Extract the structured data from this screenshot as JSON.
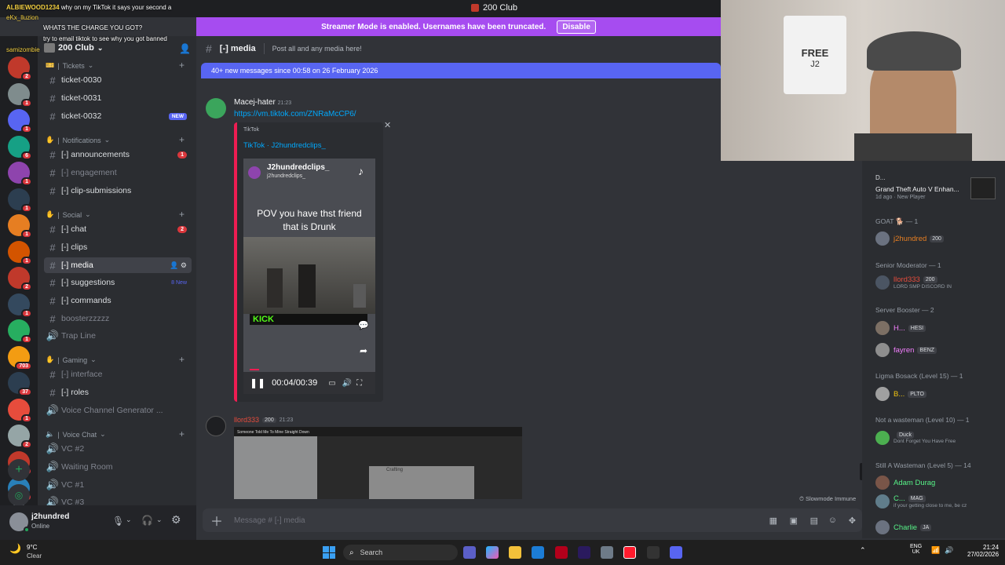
{
  "window": {
    "title": "200 Club"
  },
  "streamer_mode": {
    "text": "Streamer Mode is enabled. Usernames have been truncated.",
    "button": "Disable"
  },
  "chat_overlay": [
    {
      "user": "ALBIEWOOD1234",
      "text": "why on my TikTok it says your second a"
    },
    {
      "user": "eKx_lluzion",
      "text": ""
    },
    {
      "user": "",
      "text": "WHATS THE CHARGE YOU GOT?"
    },
    {
      "user": "",
      "text": "try to email tiktok to see why you got banned"
    },
    {
      "user": "samizombie",
      "text": ""
    }
  ],
  "server": {
    "name": "200 Club"
  },
  "rail_badges": [
    "2",
    "1",
    "1",
    "6",
    "1",
    "1",
    "1",
    "1",
    "2",
    "1",
    "1",
    "703",
    "37",
    "1",
    "2",
    "6",
    "4",
    "35"
  ],
  "categories": {
    "tickets": "Tickets",
    "notifications": "Notifications",
    "social": "Social",
    "gaming": "Gaming",
    "voice": "Voice Chat"
  },
  "channels": [
    {
      "id": "ticket-0030",
      "name": "ticket-0030",
      "icon": "#"
    },
    {
      "id": "ticket-0031",
      "name": "ticket-0031",
      "icon": "#"
    },
    {
      "id": "ticket-0032",
      "name": "ticket-0032",
      "icon": "#",
      "new": "NEW"
    },
    {
      "id": "announcements",
      "name": "[-] announcements",
      "icon": "#",
      "count": "1"
    },
    {
      "id": "engagement",
      "name": "[-] engagement",
      "icon": "#",
      "dim": true
    },
    {
      "id": "clip-submissions",
      "name": "[-] clip-submissions",
      "icon": "#"
    },
    {
      "id": "chat",
      "name": "[-] chat",
      "icon": "#",
      "count": "2"
    },
    {
      "id": "clips",
      "name": "[-] clips",
      "icon": "#"
    },
    {
      "id": "media",
      "name": "[-] media",
      "icon": "#",
      "active": true
    },
    {
      "id": "suggestions",
      "name": "[-] suggestions",
      "icon": "#",
      "newtext": "8 New"
    },
    {
      "id": "commands",
      "name": "[-] commands",
      "icon": "#"
    },
    {
      "id": "boosterzzzzz",
      "name": "boosterzzzzz",
      "icon": "#",
      "dim": true
    },
    {
      "id": "trap-line",
      "name": "Trap Line",
      "icon": "🔊",
      "dim": true
    },
    {
      "id": "interface",
      "name": "[-] interface",
      "icon": "#",
      "dim": true
    },
    {
      "id": "roles",
      "name": "[-] roles",
      "icon": "#"
    },
    {
      "id": "voice-gen",
      "name": "Voice Channel Generator ...",
      "icon": "🔊",
      "dim": true
    },
    {
      "id": "vc2",
      "name": "VC #2",
      "icon": "🔊",
      "dim": true
    },
    {
      "id": "waiting-room",
      "name": "Waiting Room",
      "icon": "🔊",
      "dim": true
    },
    {
      "id": "vc1",
      "name": "VC #1",
      "icon": "🔊",
      "dim": true
    },
    {
      "id": "vc3",
      "name": "VC #3",
      "icon": "🔊",
      "dim": true
    }
  ],
  "user": {
    "name": "j2hundred",
    "status": "Online"
  },
  "channel_header": {
    "name": "[-] media",
    "topic": "Post all and any media here!"
  },
  "new_messages_bar": "40+ new messages since 00:58 on 26 February 2026",
  "messages": [
    {
      "author": "Macej-hater",
      "time": "21:23",
      "link": "https://vm.tiktok.com/ZNRaMcCP6/",
      "embed": {
        "provider": "TikTok",
        "title": "TikTok · J2hundredclips_",
        "account": "J2hundredclips_",
        "handle": "j2hundredclips_",
        "caption": "POV  you have thst friend that is Drunk",
        "brand": "KICK",
        "time": "00:04/00:39"
      }
    },
    {
      "author": "llord333",
      "tag": "200",
      "time": "21:23",
      "image_caption": "Someone Told Me To Mine Straight Down",
      "crafting": "Crafting"
    }
  ],
  "slowmode": "Slowmode Immune",
  "message_placeholder": "Message # [-] media",
  "activity": {
    "user": "D...",
    "game": "Grand Theft Auto V Enhan...",
    "meta": "1d ago",
    "badge": "New Player"
  },
  "member_groups": [
    {
      "header": "GOAT 🐕 — 1",
      "members": [
        {
          "name": "j2hundred",
          "tag": "200",
          "color": "#e67e22"
        }
      ]
    },
    {
      "header": "Senior Moderator — 1",
      "members": [
        {
          "name": "llord333",
          "tag": "200",
          "color": "#e74c3c",
          "sub": "LORD SMP DISCORD IN"
        }
      ]
    },
    {
      "header": "Server Booster — 2",
      "members": [
        {
          "name": "H...",
          "tag": "HESI",
          "color": "#f47fff"
        },
        {
          "name": "fayren",
          "tag": "BENZ",
          "color": "#f47fff"
        }
      ]
    },
    {
      "header": "Ligma Bosack (Level 15) — 1",
      "members": [
        {
          "name": "B...",
          "tag": "PLTO",
          "color": "#f1c40f"
        }
      ]
    },
    {
      "header": "Not a wasteman (Level 10) — 1",
      "members": [
        {
          "name": "",
          "tag": "Duck",
          "color": "#3498db",
          "sub": "Dont Forget You Have Free"
        }
      ]
    },
    {
      "header": "Still A Wasteman (Level 5) — 14",
      "members": [
        {
          "name": "Adam Durag",
          "color": "#57f287"
        },
        {
          "name": "C...",
          "tag": "MAG",
          "color": "#57f287",
          "sub": "if your getting close to me, be cz"
        },
        {
          "name": "Charlie",
          "tag": "JA",
          "color": "#57f287"
        }
      ]
    }
  ],
  "taskbar": {
    "weather_temp": "9°C",
    "weather_desc": "Clear",
    "search": "Search",
    "lang": "ENG",
    "region": "UK",
    "time": "21:24",
    "date": "27/02/2026"
  },
  "webcam": {
    "shirt_text": "FREE",
    "shirt_sub": "J2"
  },
  "colors": {
    "accent": "#5865f2",
    "streamer_bar": "#a64cf0",
    "danger": "#da373c",
    "tiktok_border": "#ee1d52"
  }
}
